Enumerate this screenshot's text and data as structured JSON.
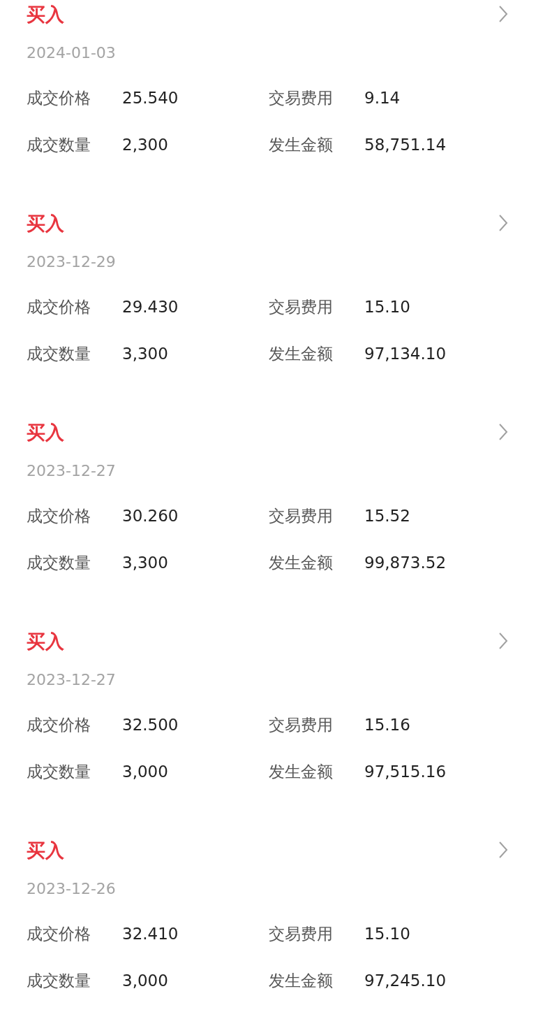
{
  "records": [
    {
      "title": "买入",
      "date": "2024-01-03",
      "fields": [
        {
          "label": "成交价格",
          "value": "25.540"
        },
        {
          "label": "交易费用",
          "value": "9.14"
        },
        {
          "label": "成交数量",
          "value": "2,300"
        },
        {
          "label": "发生金额",
          "value": "58,751.14"
        }
      ]
    },
    {
      "title": "买入",
      "date": "2023-12-29",
      "fields": [
        {
          "label": "成交价格",
          "value": "29.430"
        },
        {
          "label": "交易费用",
          "value": "15.10"
        },
        {
          "label": "成交数量",
          "value": "3,300"
        },
        {
          "label": "发生金额",
          "value": "97,134.10"
        }
      ]
    },
    {
      "title": "买入",
      "date": "2023-12-27",
      "fields": [
        {
          "label": "成交价格",
          "value": "30.260"
        },
        {
          "label": "交易费用",
          "value": "15.52"
        },
        {
          "label": "成交数量",
          "value": "3,300"
        },
        {
          "label": "发生金额",
          "value": "99,873.52"
        }
      ]
    },
    {
      "title": "买入",
      "date": "2023-12-27",
      "fields": [
        {
          "label": "成交价格",
          "value": "32.500"
        },
        {
          "label": "交易费用",
          "value": "15.16"
        },
        {
          "label": "成交数量",
          "value": "3,000"
        },
        {
          "label": "发生金额",
          "value": "97,515.16"
        }
      ]
    },
    {
      "title": "买入",
      "date": "2023-12-26",
      "fields": [
        {
          "label": "成交价格",
          "value": "32.410"
        },
        {
          "label": "交易费用",
          "value": "15.10"
        },
        {
          "label": "成交数量",
          "value": "3,000"
        },
        {
          "label": "发生金额",
          "value": "97,245.10"
        }
      ]
    }
  ]
}
